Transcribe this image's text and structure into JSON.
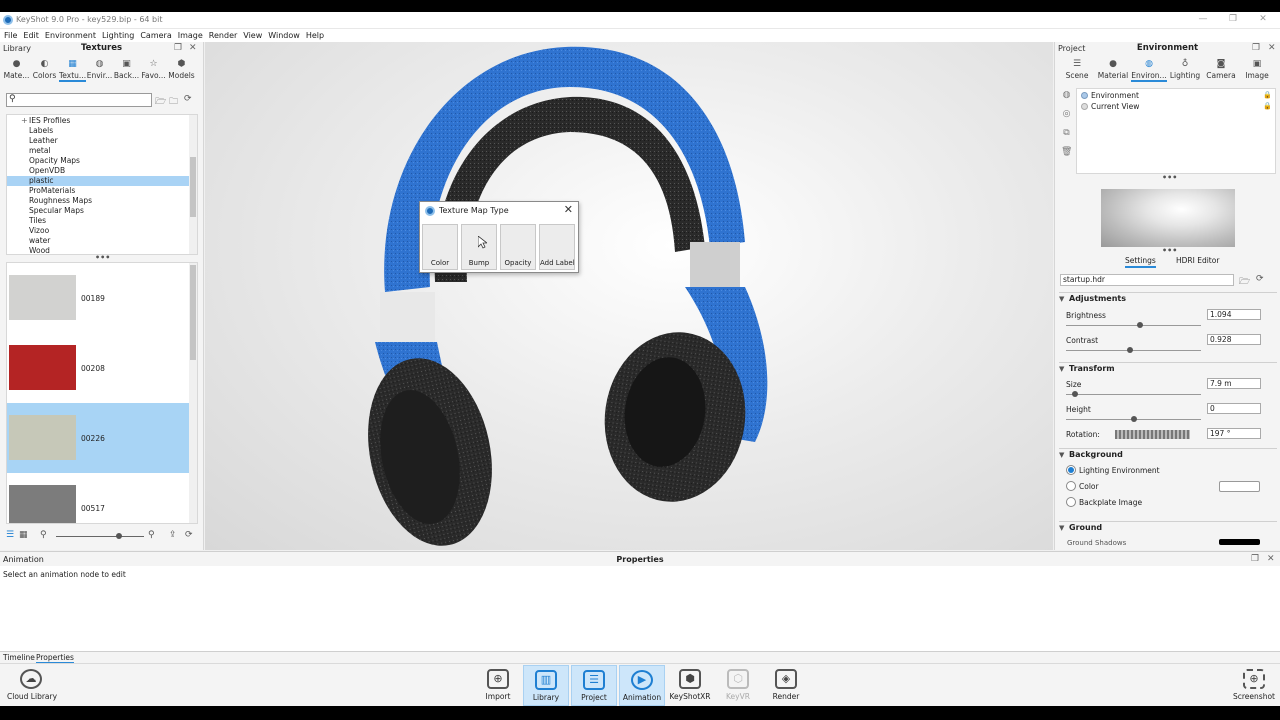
{
  "title_bar": {
    "title": "KeyShot 9.0 Pro  -  key529.bip  -  64 bit",
    "min": "—",
    "max": "❐",
    "close": "✕"
  },
  "menu": [
    "File",
    "Edit",
    "Environment",
    "Lighting",
    "Camera",
    "Image",
    "Render",
    "View",
    "Window",
    "Help"
  ],
  "library": {
    "label": "Library",
    "title": "Textures",
    "tabs": [
      {
        "label": "Mate...",
        "icon": "material-icon"
      },
      {
        "label": "Colors",
        "icon": "colors-icon"
      },
      {
        "label": "Textu...",
        "icon": "texture-icon"
      },
      {
        "label": "Envir...",
        "icon": "environment-icon"
      },
      {
        "label": "Back...",
        "icon": "backplate-icon"
      },
      {
        "label": "Favo...",
        "icon": "favorites-icon"
      },
      {
        "label": "Models",
        "icon": "models-icon"
      }
    ],
    "search_placeholder": "",
    "tree": [
      "IES Profiles",
      "Labels",
      "Leather",
      "metal",
      "Opacity Maps",
      "OpenVDB",
      "plastic",
      "ProMaterials",
      "Roughness Maps",
      "Specular Maps",
      "Tiles",
      "Vizoo",
      "water",
      "Wood"
    ],
    "selected_tree": "plastic",
    "thumbnails": [
      {
        "name": "00189",
        "color": "#d2d2d0"
      },
      {
        "name": "00208",
        "color": "#b42424"
      },
      {
        "name": "00226",
        "color": "#c6c8b8"
      },
      {
        "name": "00517",
        "color": "#7c7c7c"
      }
    ]
  },
  "dialog": {
    "title": "Texture Map Type",
    "close": "✕",
    "buttons": [
      "Color",
      "Bump",
      "Opacity",
      "Add Label"
    ]
  },
  "project": {
    "label": "Project",
    "title": "Environment",
    "tabs": [
      {
        "label": "Scene",
        "icon": "scene-icon"
      },
      {
        "label": "Material",
        "icon": "material-icon"
      },
      {
        "label": "Environ...",
        "icon": "environment-icon"
      },
      {
        "label": "Lighting",
        "icon": "lighting-icon"
      },
      {
        "label": "Camera",
        "icon": "camera-icon"
      },
      {
        "label": "Image",
        "icon": "image-icon"
      }
    ],
    "env_list": [
      "Environment",
      "Current View"
    ],
    "subtabs": [
      "Settings",
      "HDRI Editor"
    ],
    "hdr_file": "startup.hdr",
    "sections": {
      "adjustments": "Adjustments",
      "transform": "Transform",
      "background": "Background",
      "ground": "Ground"
    },
    "fields": {
      "brightness_label": "Brightness",
      "brightness": "1.094",
      "brightness_level": 0.55,
      "contrast_label": "Contrast",
      "contrast": "0.928",
      "contrast_level": 0.47,
      "size_label": "Size",
      "size": "7.9 m",
      "size_level": 0.05,
      "height_label": "Height",
      "height": "0",
      "height_level": 0.5,
      "rotation_label": "Rotation:",
      "rotation": "197 °"
    },
    "background_options": [
      "Lighting Environment",
      "Color",
      "Backplate Image"
    ],
    "background_selected": "Lighting Environment",
    "ground_first": "Ground Shadows"
  },
  "properties": {
    "left_label": "Animation",
    "title": "Properties",
    "message": "Select an animation node to edit",
    "tabs": [
      "Timeline",
      "Properties"
    ]
  },
  "toolbar": {
    "cloud": "Cloud Library",
    "buttons": [
      {
        "label": "Import",
        "icon": "import-icon",
        "state": "normal"
      },
      {
        "label": "Library",
        "icon": "library-icon",
        "state": "active"
      },
      {
        "label": "Project",
        "icon": "project-icon",
        "state": "active"
      },
      {
        "label": "Animation",
        "icon": "animation-icon",
        "state": "active"
      },
      {
        "label": "KeyShotXR",
        "icon": "keyshotxr-icon",
        "state": "normal"
      },
      {
        "label": "KeyVR",
        "icon": "keyvr-icon",
        "state": "disabled"
      },
      {
        "label": "Render",
        "icon": "render-icon",
        "state": "normal"
      }
    ],
    "screenshot": "Screenshot"
  },
  "colors": {
    "accent": "#1e7fd2",
    "selection": "#a9d3f5",
    "headphone_blue": "#2f73d0",
    "headphone_dark": "#2b2b2b"
  }
}
